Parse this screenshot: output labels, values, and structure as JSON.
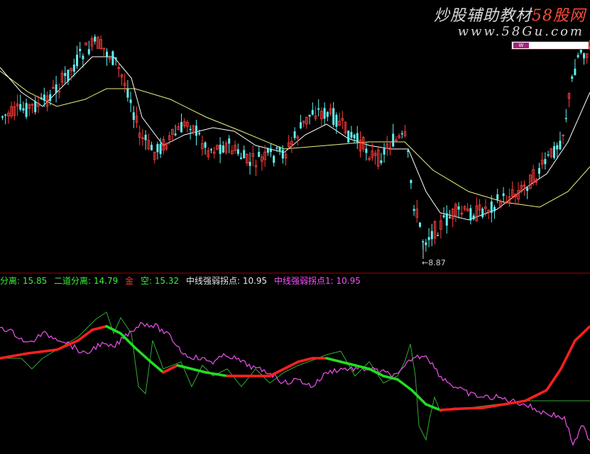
{
  "watermark": {
    "title": "炒股辅助教材",
    "site": "58股网",
    "url": "www.58Gu.com",
    "badge": "W"
  },
  "main_chart": {
    "low_marker": "←8.87"
  },
  "indicator": {
    "items": [
      {
        "label": "分离: 15.85",
        "color": "#3cf03c"
      },
      {
        "label": "二道分离: 14.79",
        "color": "#3cf03c"
      },
      {
        "label": "金",
        "color": "#ff3333"
      },
      {
        "label": "空: 15.32",
        "color": "#3cf03c"
      },
      {
        "label": "中线强弱拐点: 10.95",
        "color": "#e6e6e6"
      },
      {
        "label": "中线强弱拐点1: 10.95",
        "color": "#ff4dff"
      }
    ]
  },
  "colors": {
    "up_candle": "#ff3b3b",
    "down_candle": "#5ff0f0",
    "ma_long": "#f0f080",
    "ma_short": "#ffffff",
    "divider": "#a00000",
    "green_line": "#22dd22",
    "red_line": "#ff2020",
    "magenta_line": "#e04de0",
    "thin_green": "#33aa33"
  },
  "icons": [
    "arrow-left-icon"
  ]
}
